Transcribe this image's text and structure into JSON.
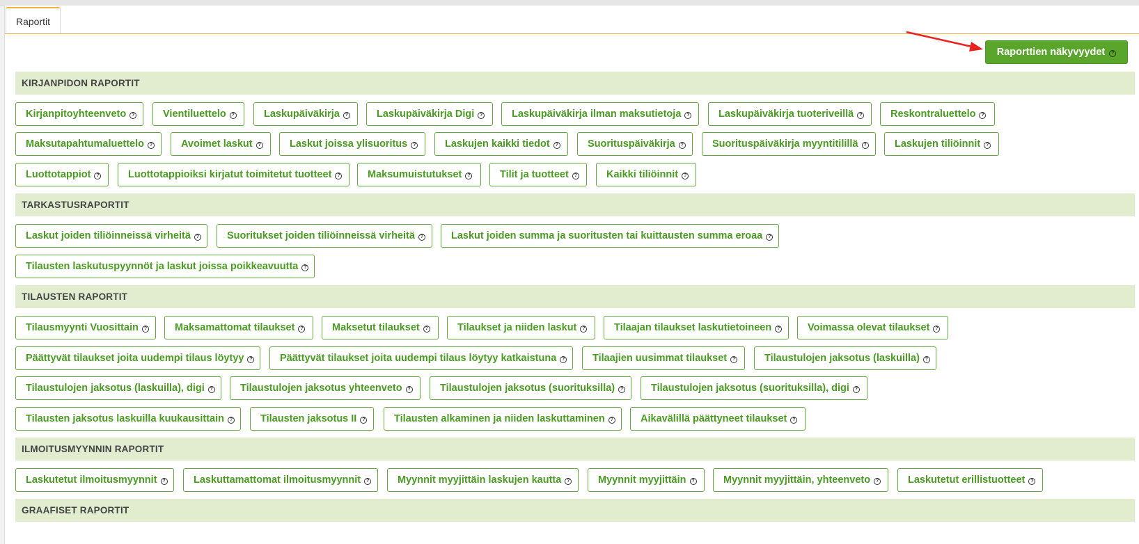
{
  "tab": {
    "label": "Raportit"
  },
  "visibility_button": {
    "label": "Raporttien näkyvyydet"
  },
  "help_glyph": "?",
  "sections": [
    {
      "title": "KIRJANPIDON RAPORTIT",
      "items": [
        "Kirjanpitoyhteenveto",
        "Vientiluettelo",
        "Laskupäiväkirja",
        "Laskupäiväkirja Digi",
        "Laskupäiväkirja ilman maksutietoja",
        "Laskupäiväkirja tuoteriveillä",
        "Reskontraluettelo",
        "Maksutapahtumaluettelo",
        "Avoimet laskut",
        "Laskut joissa ylisuoritus",
        "Laskujen kaikki tiedot",
        "Suorituspäiväkirja",
        "Suorituspäiväkirja myyntitilillä",
        "Laskujen tiliöinnit",
        "Luottotappiot",
        "Luottotappioiksi kirjatut toimitetut tuotteet",
        "Maksumuistutukset",
        "Tilit ja tuotteet",
        "Kaikki tiliöinnit"
      ]
    },
    {
      "title": "TARKASTUSRAPORTIT",
      "items": [
        "Laskut joiden tiliöinneissä virheitä",
        "Suoritukset joiden tiliöinneissä virheitä",
        "Laskut joiden summa ja suoritusten tai kuittausten summa eroaa",
        "Tilausten laskutuspyynnöt ja laskut joissa poikkeavuutta"
      ]
    },
    {
      "title": "TILAUSTEN RAPORTIT",
      "items": [
        "Tilausmyynti Vuosittain",
        "Maksamattomat tilaukset",
        "Maksetut tilaukset",
        "Tilaukset ja niiden laskut",
        "Tilaajan tilaukset laskutietoineen",
        "Voimassa olevat tilaukset",
        "Päättyvät tilaukset joita uudempi tilaus löytyy",
        "Päättyvät tilaukset joita uudempi tilaus löytyy katkaistuna",
        "Tilaajien uusimmat tilaukset",
        "Tilaustulojen jaksotus (laskuilla)",
        "Tilaustulojen jaksotus (laskuilla), digi",
        "Tilaustulojen jaksotus yhteenveto",
        "Tilaustulojen jaksotus (suorituksilla)",
        "Tilaustulojen jaksotus (suorituksilla), digi",
        "Tilausten jaksotus laskuilla kuukausittain",
        "Tilausten jaksotus II",
        "Tilausten alkaminen ja niiden laskuttaminen",
        "Aikavälillä päättyneet tilaukset"
      ]
    },
    {
      "title": "ILMOITUSMYYNNIN RAPORTIT",
      "items": [
        "Laskutetut ilmoitusmyynnit",
        "Laskuttamattomat ilmoitusmyynnit",
        "Myynnit myyjittäin laskujen kautta",
        "Myynnit myyjittäin",
        "Myynnit myyjittäin, yhteenveto",
        "Laskutetut erillistuotteet"
      ]
    },
    {
      "title": "GRAAFISET RAPORTIT",
      "items": []
    }
  ]
}
